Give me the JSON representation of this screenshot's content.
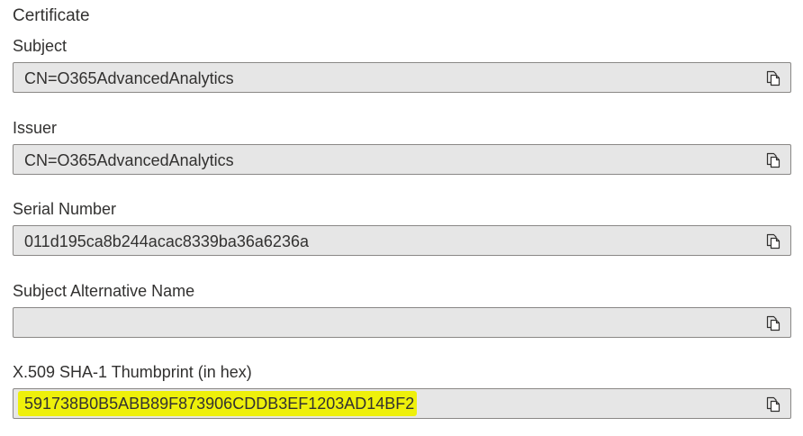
{
  "section_title": "Certificate",
  "fields": {
    "subject": {
      "label": "Subject",
      "value": "CN=O365AdvancedAnalytics"
    },
    "issuer": {
      "label": "Issuer",
      "value": "CN=O365AdvancedAnalytics"
    },
    "serial_number": {
      "label": "Serial Number",
      "value": "011d195ca8b244acac8339ba36a6236a"
    },
    "subject_alt_name": {
      "label": "Subject Alternative Name",
      "value": ""
    },
    "thumbprint": {
      "label": "X.509 SHA-1 Thumbprint (in hex)",
      "value": "591738B0B5ABB89F873906CDDB3EF1203AD14BF2"
    }
  },
  "icons": {
    "copy": "copy-icon"
  },
  "colors": {
    "field_background": "#e6e6e6",
    "field_border": "#8a8886",
    "highlight": "#eef00b",
    "text": "#323130"
  }
}
